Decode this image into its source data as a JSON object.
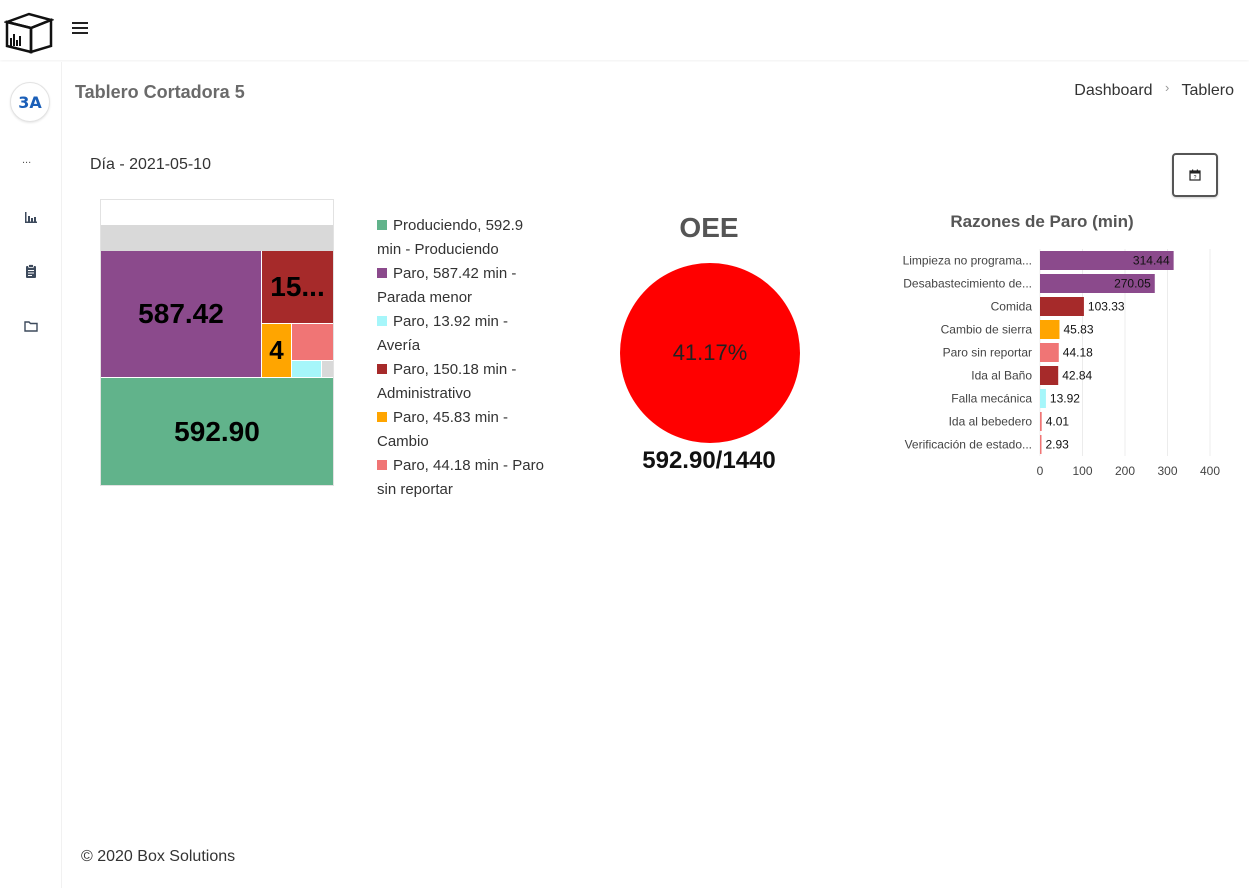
{
  "header": {
    "menu_icon": "hamburger-icon",
    "logo_icon": "box-logo-icon"
  },
  "sidebar": {
    "avatar_text": "3A",
    "dots": "...",
    "icons": [
      "bar-chart-icon",
      "clipboard-icon",
      "folder-icon"
    ]
  },
  "page": {
    "title": "Tablero Cortadora 5",
    "breadcrumb": [
      "Dashboard",
      "Tablero"
    ],
    "day_label": "Día - 2021-05-10",
    "calendar_icon": "calendar-icon"
  },
  "treemap": {
    "labels": [
      "592.90",
      "587.42",
      "15...",
      "4"
    ],
    "colors": {
      "producing": "#61b38b",
      "minor": "#8b4a8c",
      "admin": "#a62a2a",
      "change": "#ffa500",
      "unreported": "#f07575",
      "breakdown": "#a6f6fa",
      "other": "#d9d9d9"
    }
  },
  "legend": [
    {
      "text": "Produciendo, 592.9 min - Produciendo",
      "color": "#61b38b"
    },
    {
      "text": "Paro, 587.42 min - Parada menor",
      "color": "#8b4a8c"
    },
    {
      "text": "Paro, 13.92 min - Avería",
      "color": "#a6f6fa"
    },
    {
      "text": "Paro, 150.18 min - Administrativo",
      "color": "#a62a2a"
    },
    {
      "text": "Paro, 45.83 min - Cambio",
      "color": "#ffa500"
    },
    {
      "text": "Paro, 44.18 min - Paro sin reportar",
      "color": "#f07575"
    }
  ],
  "oee": {
    "title": "OEE",
    "percent_label": "41.17%",
    "ratio": "592.90/1440",
    "color": "#ff0000"
  },
  "chart_data": {
    "type": "bar",
    "orientation": "horizontal",
    "title": "Razones de Paro (min)",
    "categories": [
      "Limpieza no programa...",
      "Desabastecimiento de...",
      "Comida",
      "Cambio de sierra",
      "Paro sin reportar",
      "Ida al Baño",
      "Falla mecánica",
      "Ida al bebedero",
      "Verificación de estado..."
    ],
    "values": [
      314.44,
      270.05,
      103.33,
      45.83,
      44.18,
      42.84,
      13.92,
      4.01,
      2.93
    ],
    "value_labels": [
      "314.44",
      "270.05",
      "103.33",
      "45.83",
      "44.18",
      "42.84",
      "13.92",
      "4.01",
      "2.93"
    ],
    "colors": [
      "#8b4a8c",
      "#8b4a8c",
      "#a62a2a",
      "#ffa500",
      "#f07575",
      "#a62a2a",
      "#a6f6fa",
      "#f07575",
      "#f07575"
    ],
    "xlim": [
      0,
      400
    ],
    "xticks": [
      0,
      100,
      200,
      300,
      400
    ],
    "grid": true
  },
  "footer": {
    "text": "© 2020 Box Solutions"
  }
}
